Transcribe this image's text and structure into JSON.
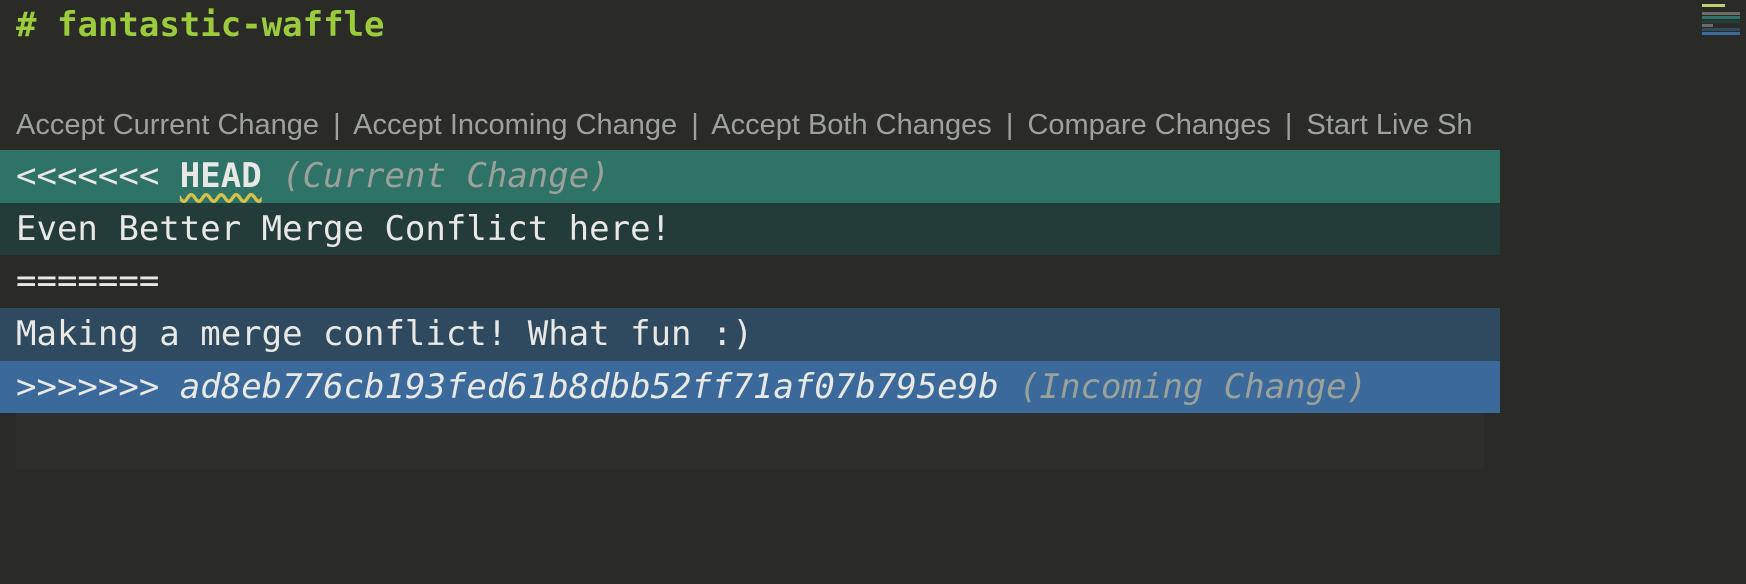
{
  "title": {
    "hash": "#",
    "text": "fantastic-waffle"
  },
  "codelens": {
    "accept_current": "Accept Current Change",
    "accept_incoming": "Accept Incoming Change",
    "accept_both": "Accept Both Changes",
    "compare": "Compare Changes",
    "start_live": "Start Live Sh",
    "separator": "|"
  },
  "conflict": {
    "head_marker": "<<<<<<<",
    "head_ref": "HEAD",
    "current_annotation": "(Current Change)",
    "current_content": "Even Better Merge Conflict here!",
    "separator": "=======",
    "incoming_content": "Making a merge conflict! What fun :)",
    "incoming_marker": ">>>>>>>",
    "incoming_hash": "ad8eb776cb193fed61b8dbb52ff71af07b795e9b",
    "incoming_annotation": "(Incoming Change)"
  }
}
